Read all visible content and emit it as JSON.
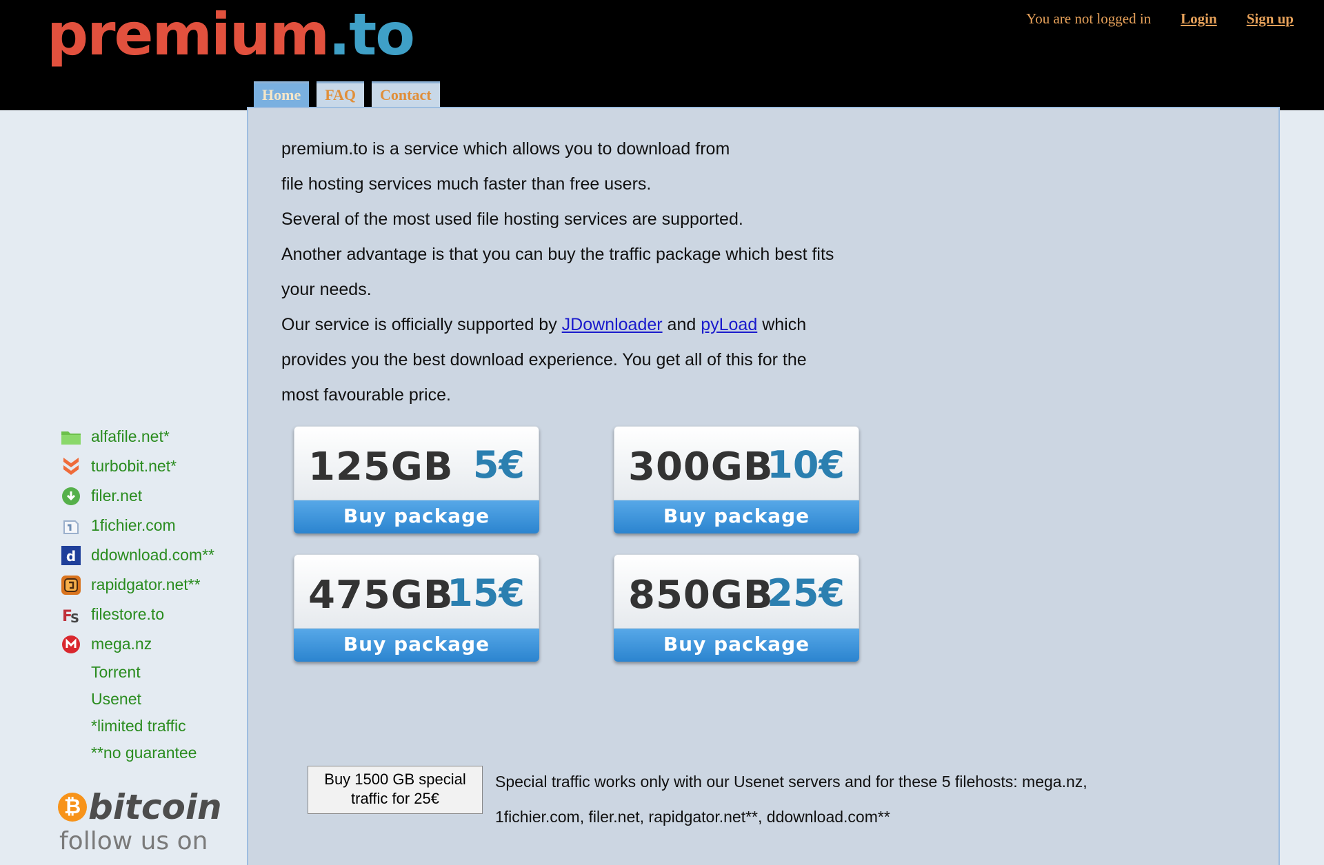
{
  "header": {
    "logo": {
      "part1": "premium",
      "part2": ".to"
    },
    "login_status": "You are not logged in",
    "login_label": "Login",
    "signup_label": "Sign up"
  },
  "nav": {
    "tabs": [
      {
        "label": "Home",
        "active": true
      },
      {
        "label": "FAQ"
      },
      {
        "label": "Contact"
      }
    ]
  },
  "intro": {
    "line1": "premium.to is a service which allows you to download from",
    "line2": "file hosting services much faster than free users.",
    "line3": "Several of the most used file hosting services are supported.",
    "line4": "Another advantage is that you can buy the traffic package which best fits",
    "line5": "your needs.",
    "line6_a": "Our service is officially supported by",
    "link1": "JDownloader",
    "line6_b": "and",
    "link2": "pyLoad",
    "line6_c": "which",
    "line7": "provides you the best download experience. You get all of this for the",
    "line8": "most favourable price."
  },
  "packages": [
    {
      "gb": "125GB",
      "price": "5€",
      "button": "Buy package"
    },
    {
      "gb": "300GB",
      "price": "10€",
      "button": "Buy package"
    },
    {
      "gb": "475GB",
      "price": "15€",
      "button": "Buy package"
    },
    {
      "gb": "850GB",
      "price": "25€",
      "button": "Buy package"
    }
  ],
  "hosts": [
    {
      "label": "alfafile.net*",
      "icon": "folder-icon"
    },
    {
      "label": "turbobit.net*",
      "icon": "chevrons-icon"
    },
    {
      "label": "filer.net",
      "icon": "download-circle-icon"
    },
    {
      "label": "1fichier.com",
      "icon": "fichier-icon"
    },
    {
      "label": "ddownload.com**",
      "icon": "d-icon"
    },
    {
      "label": "rapidgator.net**",
      "icon": "rapidgator-icon"
    },
    {
      "label": "filestore.to",
      "icon": "fs-icon"
    },
    {
      "label": "mega.nz",
      "icon": "mega-icon"
    }
  ],
  "extra_hosts": [
    "Torrent",
    "Usenet"
  ],
  "notes": [
    "*limited traffic",
    "**no guarantee"
  ],
  "special": {
    "button_line1": "Buy 1500 GB special",
    "button_line2": "traffic for 25€",
    "note_line1": "Special traffic works only with our Usenet servers and for these 5 filehosts: mega.nz,",
    "note_line2": "1fichier.com, filer.net, rapidgator.net**, ddownload.com**"
  },
  "bitcoin": {
    "symbol": "₿",
    "word": "bitcoin"
  },
  "follow": "follow us on"
}
